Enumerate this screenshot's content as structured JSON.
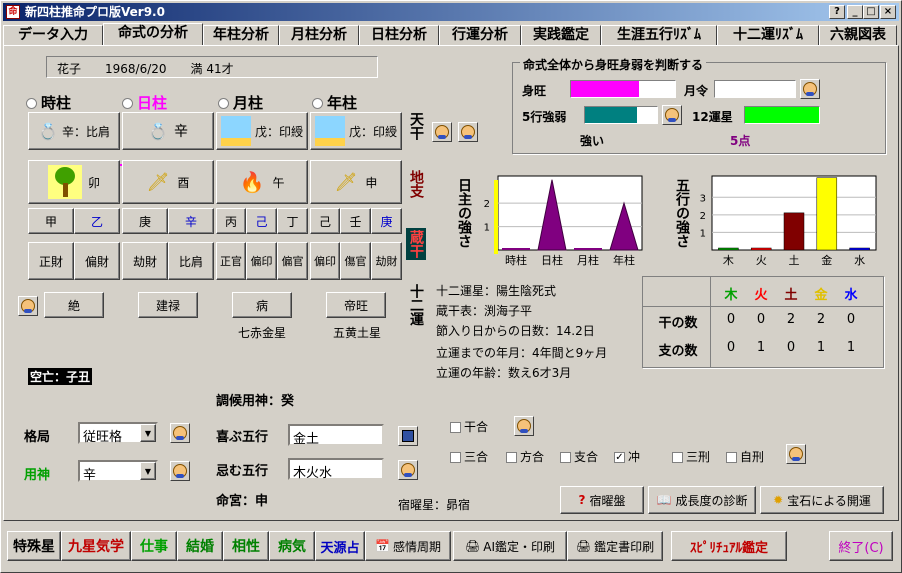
{
  "window": {
    "title": "新四柱推命プロ版Ver9.0",
    "min": "_",
    "max": "□",
    "close": "×",
    "help": "?"
  },
  "tabs": [
    "データ入力",
    "命式の分析",
    "年柱分析",
    "月柱分析",
    "日柱分析",
    "行運分析",
    "実践鑑定",
    "生涯五行ﾘｽﾞﾑ",
    "十二運ﾘｽﾞﾑ",
    "六親図表"
  ],
  "profile": {
    "text": "花子　　1968/6/20　　満 41才"
  },
  "pillars": {
    "hour": "時柱",
    "day": "日柱",
    "month": "月柱",
    "year": "年柱",
    "tenkan_label": "天干",
    "chishi_label": "地支",
    "zoukan_label": "蔵干",
    "juniun_label": "十二運"
  },
  "stems": {
    "hour": "辛：比肩",
    "day": "辛",
    "month": "戊：印綬",
    "year": "戊：印綬"
  },
  "branches": {
    "hour": "卯",
    "day": "酉",
    "month": "午",
    "year": "申"
  },
  "hidden": {
    "hour": [
      "甲",
      "乙"
    ],
    "day": [
      "庚",
      "辛"
    ],
    "month": [
      "丙",
      "己",
      "丁"
    ],
    "year": [
      "己",
      "壬",
      "庚"
    ]
  },
  "gods": {
    "hour": [
      "正財",
      "偏財"
    ],
    "day": [
      "劫財",
      "比肩"
    ],
    "month": [
      "正官",
      "偏印",
      "偏官"
    ],
    "year": [
      "偏印",
      "傷官",
      "劫財"
    ]
  },
  "twelve": {
    "hour": "絶",
    "day": "建禄",
    "month": "病",
    "year": "帝旺"
  },
  "stars": {
    "month": "七赤金星",
    "year": "五黄土星"
  },
  "kubo": "空亡：子丑",
  "strength": {
    "title": "命式全体から身旺身弱を判断する",
    "shinou": "身旺",
    "getsurei": "月令",
    "gogyou": "5行強弱",
    "juniun": "12運星",
    "result": "強い",
    "points": "5点",
    "shinou_fill": 0.65,
    "gogyou_fill": 0.72,
    "juniun_fill": 1.0,
    "getsurei_fill": 0.0
  },
  "chart_data": [
    {
      "type": "area",
      "title": "日主の強さ",
      "categories": [
        "時柱",
        "日柱",
        "月柱",
        "年柱"
      ],
      "values": [
        0,
        3,
        0,
        2
      ],
      "ylim": [
        0,
        3
      ]
    },
    {
      "type": "bar",
      "title": "五行の強さ",
      "categories": [
        "木",
        "火",
        "土",
        "金",
        "水"
      ],
      "values": [
        0,
        0,
        2,
        4,
        0
      ],
      "ylim": [
        0,
        4
      ]
    }
  ],
  "info": {
    "l1": "十二運星：陽生陰死式",
    "l2": "蔵干表：渕海子平",
    "l3": "節入り日からの日数：14.2日",
    "l4": "立運までの年月：4年間と9ヶ月",
    "l5": "立運の年齢：数え6才3月"
  },
  "table": {
    "headers": [
      "木",
      "火",
      "土",
      "金",
      "水"
    ],
    "row1_label": "干の数",
    "row1": [
      "0",
      "0",
      "2",
      "2",
      "0"
    ],
    "row2_label": "支の数",
    "row2": [
      "0",
      "1",
      "0",
      "1",
      "1"
    ]
  },
  "choukou": "調候用神：癸",
  "kakkyoku": {
    "label": "格局",
    "value": "従旺格"
  },
  "youjin": {
    "label": "用神",
    "value": "辛"
  },
  "kibi": {
    "label": "喜ぶ五行",
    "value": "金土"
  },
  "imu": {
    "label": "忌む五行",
    "value": "木火水"
  },
  "meikyu": "命宮：申",
  "shuku": "宿曜星：昴宿",
  "checks": {
    "kangou": "干合",
    "sangou": "三合",
    "hougou": "方合",
    "shigou": "支合",
    "chuu": "冲",
    "sankei": "三刑",
    "jikei": "自刑"
  },
  "actions": {
    "sukuyou": "宿曜盤",
    "seichou": "成長度の診断",
    "houseki": "宝石による開運"
  },
  "bottom": {
    "b1": "特殊星",
    "b2": "九星気学",
    "b3": "仕事",
    "b4": "結婚",
    "b5": "相性",
    "b6": "病気",
    "b7": "天源占",
    "b8": "感情周期",
    "b9": "AI鑑定・印刷",
    "b10": "鑑定書印刷",
    "b11": "ｽﾋﾟﾘﾁｭｱﾙ鑑定",
    "b12": "終了(C)"
  },
  "colors": {
    "magenta": "#ff00ff",
    "teal": "#008080",
    "green": "#00ff00",
    "darkred": "#800000",
    "yellow": "#ffff00",
    "purple": "#800080"
  }
}
